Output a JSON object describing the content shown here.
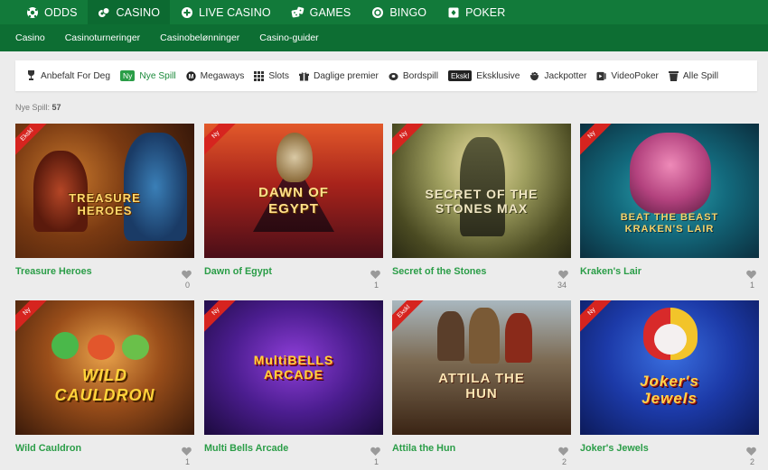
{
  "topnav": [
    {
      "label": "ODDS",
      "icon": "football-icon"
    },
    {
      "label": "CASINO",
      "icon": "chips-icon",
      "active": true
    },
    {
      "label": "LIVE CASINO",
      "icon": "plus-circle-icon"
    },
    {
      "label": "GAMES",
      "icon": "dice-icon"
    },
    {
      "label": "BINGO",
      "icon": "bingo-ball-icon"
    },
    {
      "label": "POKER",
      "icon": "cards-icon"
    }
  ],
  "subnav": [
    "Casino",
    "Casinoturneringer",
    "Casinobelønninger",
    "Casino-guider"
  ],
  "filters": [
    {
      "label": "Anbefalt For Deg",
      "icon": "trophy-icon"
    },
    {
      "label": "Nye Spill",
      "badge": "Ny",
      "active": true
    },
    {
      "label": "Megaways",
      "icon": "megaways-icon"
    },
    {
      "label": "Slots",
      "icon": "grid-icon"
    },
    {
      "label": "Daglige premier",
      "icon": "gift-icon"
    },
    {
      "label": "Bordspill",
      "icon": "chip-icon"
    },
    {
      "label": "Eksklusive",
      "badge": "Ekskl"
    },
    {
      "label": "Jackpotter",
      "icon": "pot-icon"
    },
    {
      "label": "VideoPoker",
      "icon": "videopoker-icon"
    },
    {
      "label": "Alle Spill",
      "icon": "bucket-icon"
    }
  ],
  "count": {
    "label": "Nye Spill:",
    "value": "57"
  },
  "games": [
    {
      "title": "Treasure Heroes",
      "likes": "0",
      "ribbon": "Ekskl",
      "logo": "TREASURE HEROES"
    },
    {
      "title": "Dawn of Egypt",
      "likes": "1",
      "ribbon": "Ny",
      "logo": "DAWN OF EGYPT"
    },
    {
      "title": "Secret of the Stones",
      "likes": "34",
      "ribbon": "Ny",
      "logo": "SECRET OF THE STONES MAX"
    },
    {
      "title": "Kraken's Lair",
      "likes": "1",
      "ribbon": "Ny",
      "logo": "BEAT THE BEAST KRAKEN'S LAIR"
    },
    {
      "title": "Wild Cauldron",
      "likes": "1",
      "ribbon": "Ny",
      "logo": "WILD CAULDRON"
    },
    {
      "title": "Multi Bells Arcade",
      "likes": "1",
      "ribbon": "Ny",
      "logo": "MultiBELLS ARCADE"
    },
    {
      "title": "Attila the Hun",
      "likes": "2",
      "ribbon": "Ekskl",
      "logo": "ATTILA THE HUN"
    },
    {
      "title": "Joker's Jewels",
      "likes": "2",
      "ribbon": "Ny",
      "logo": "Joker's Jewels"
    }
  ]
}
